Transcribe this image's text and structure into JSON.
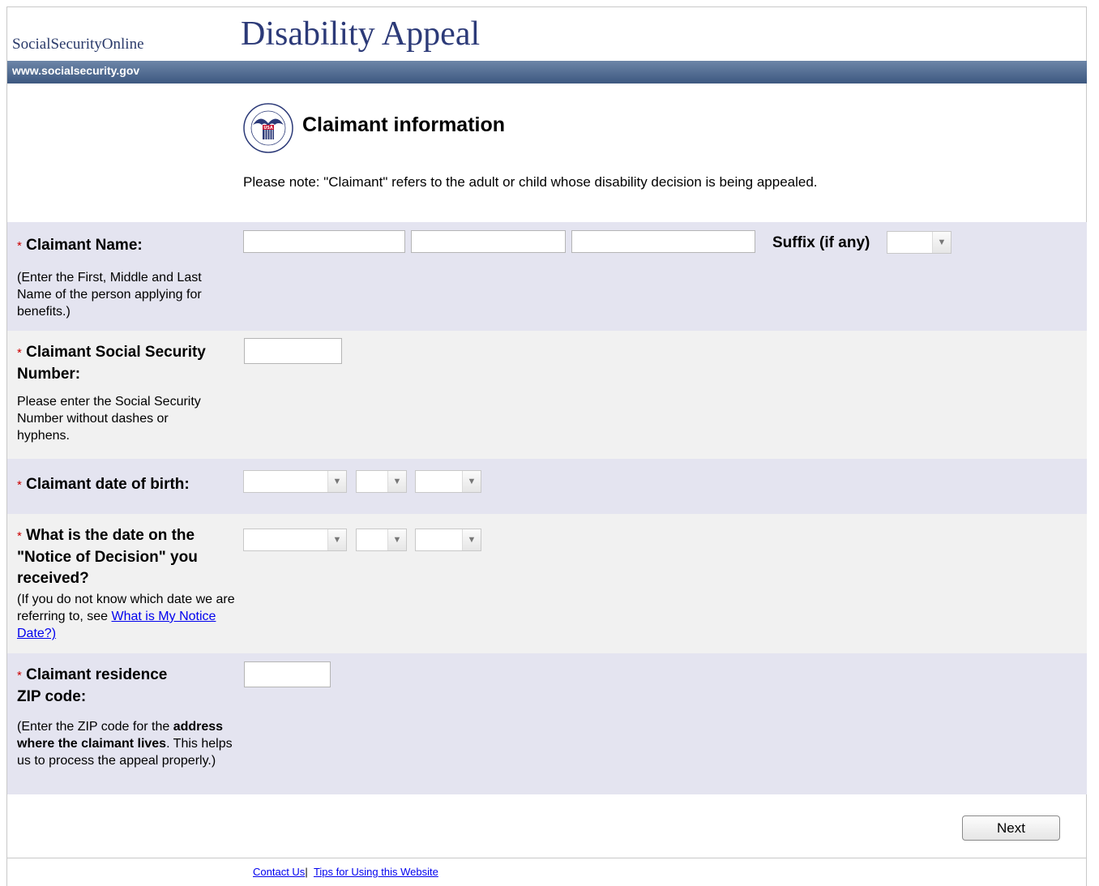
{
  "header": {
    "brand": "SocialSecurityOnline",
    "title": "Disability Appeal",
    "url": "www.socialsecurity.gov"
  },
  "section": {
    "title": "Claimant information",
    "note": "Please note: \"Claimant\" refers to the adult or child whose disability decision is being appealed."
  },
  "fields": {
    "name": {
      "required": "*",
      "label": "Claimant Name:",
      "help": "(Enter the First, Middle and Last Name of the person applying for benefits.)",
      "suffix_label": "Suffix (if any)"
    },
    "ssn": {
      "required": "*",
      "label": "Claimant Social Security Number:",
      "help": "Please enter the Social Security Number without dashes or hyphens."
    },
    "dob": {
      "required": "*",
      "label": "Claimant date of birth:"
    },
    "notice": {
      "required": "*",
      "label": "What is the date on the \"Notice of Decision\" you received?",
      "help": "(If you do not know which date we are referring to, see ",
      "link": "What is My Notice Date?)"
    },
    "zip": {
      "required": "*",
      "label_line1": "Claimant residence",
      "label_line2": "ZIP code:",
      "help_pre": "(Enter the ZIP code for the ",
      "help_bold": "address where the claimant lives",
      "help_post": ". This helps us to process the appeal properly.)"
    }
  },
  "buttons": {
    "next": "Next"
  },
  "footer": {
    "contact": "Contact Us",
    "separator": "|",
    "tips": "Tips for Using this Website"
  },
  "icons": {
    "logo": "ssa-seal-icon",
    "dropdown": "chevron-down-icon"
  },
  "colors": {
    "title": "#2c3a78",
    "bar": "#4a6488",
    "row_purple": "#e4e4f0",
    "row_gray": "#f1f1f1",
    "required": "#cc0000",
    "link": "#0000ee"
  }
}
